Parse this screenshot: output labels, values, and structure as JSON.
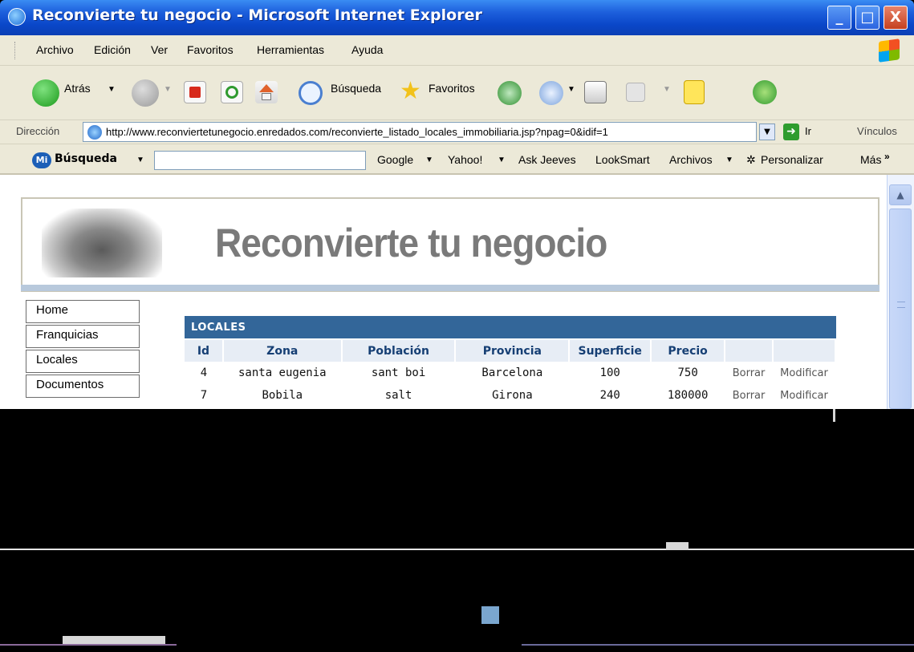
{
  "window": {
    "title": "Reconvierte tu negocio - Microsoft Internet Explorer",
    "minimize": "_",
    "maximize": "□",
    "close": "X"
  },
  "menu": [
    "Archivo",
    "Edición",
    "Ver",
    "Favoritos",
    "Herramientas",
    "Ayuda"
  ],
  "toolbar": {
    "back": "Atrás",
    "search": "Búsqueda",
    "favorites": "Favoritos"
  },
  "address": {
    "label": "Dirección",
    "url": "http://www.reconviertetunegocio.enredados.com/reconvierte_listado_locales_immobiliaria.jsp?npag=0&idif=1",
    "go": "Ir",
    "links": "Vínculos"
  },
  "search_toolbar": {
    "logo": "Mi",
    "label": "Búsqueda",
    "search_value": "",
    "items": [
      "Google",
      "Yahoo!",
      "Ask Jeeves",
      "LookSmart",
      "Archivos",
      "Personalizar",
      "Más"
    ]
  },
  "page": {
    "brand": "Reconvierte tu negocio",
    "nav": [
      "Home",
      "Franquicias",
      "Locales",
      "Documentos"
    ],
    "section_title": "LOCALES",
    "columns": [
      "Id",
      "Zona",
      "Población",
      "Provincia",
      "Superficie",
      "Precio",
      "",
      ""
    ],
    "rows": [
      {
        "id": "4",
        "zona": "santa eugenia",
        "poblacion": "sant boi",
        "provincia": "Barcelona",
        "superficie": "100",
        "precio": "750",
        "borrar": "Borrar",
        "modificar": "Modificar"
      },
      {
        "id": "7",
        "zona": "Bobila",
        "poblacion": "salt",
        "provincia": "Girona",
        "superficie": "240",
        "precio": "180000",
        "borrar": "Borrar",
        "modificar": "Modificar"
      }
    ]
  },
  "colors": {
    "title_blue": "#0a47c9",
    "section_header": "#336699",
    "column_header_bg": "#e7edf5",
    "brand_gray": "#7a7a7a"
  }
}
